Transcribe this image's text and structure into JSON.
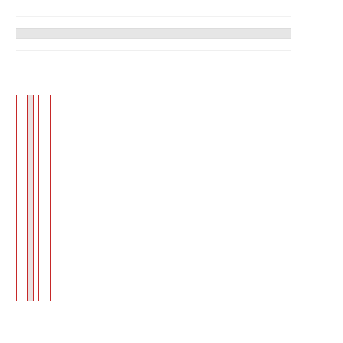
{
  "page": {
    "background": "#ffffff"
  },
  "rules": {
    "line_color": "#e6e6e6",
    "band_color": "#e6e6e6"
  },
  "vertical_lines": {
    "stroke_color": "#c62828",
    "fill_color": "#e8e0e0"
  }
}
